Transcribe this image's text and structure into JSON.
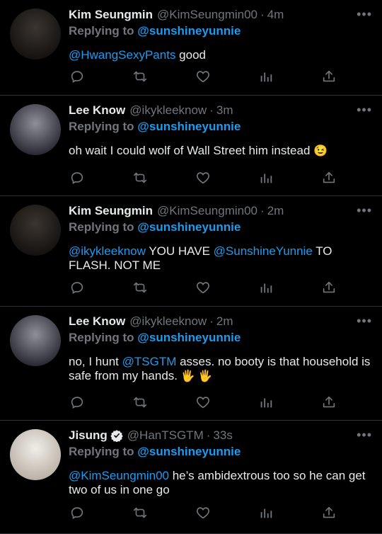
{
  "tweets": [
    {
      "name": "Kim Seungmin",
      "handle": "@KimSeungmin00",
      "time": "4m",
      "replying_prefix": "Replying to",
      "replying_handle": "@sunshineyunnie",
      "parts": [
        {
          "t": "@HwangSexyPants",
          "m": true
        },
        {
          "t": " good",
          "m": false
        }
      ],
      "avatar_colors": [
        "#3a3530",
        "#151210"
      ]
    },
    {
      "name": "Lee Know",
      "handle": "@ikykleeknow",
      "time": "3m",
      "replying_prefix": "Replying to",
      "replying_handle": "@sunshineyunnie",
      "parts": [
        {
          "t": "oh wait I could wolf of Wall Street him instead ",
          "m": false
        },
        {
          "t": "😉",
          "m": false,
          "emoji": true
        }
      ],
      "avatar_colors": [
        "#8f8f99",
        "#2c2c36"
      ]
    },
    {
      "name": "Kim Seungmin",
      "handle": "@KimSeungmin00",
      "time": "2m",
      "replying_prefix": "Replying to",
      "replying_handle": "@sunshineyunnie",
      "parts": [
        {
          "t": "@ikykleeknow",
          "m": true
        },
        {
          "t": " YOU HAVE ",
          "m": false
        },
        {
          "t": "@SunshineYunnie",
          "m": true
        },
        {
          "t": " TO FLASH. NOT ME",
          "m": false
        }
      ],
      "avatar_colors": [
        "#3a3530",
        "#151210"
      ]
    },
    {
      "name": "Lee Know",
      "handle": "@ikykleeknow",
      "time": "2m",
      "replying_prefix": "Replying to",
      "replying_handle": "@sunshineyunnie",
      "parts": [
        {
          "t": "no, I hunt ",
          "m": false
        },
        {
          "t": "@TSGTM",
          "m": true
        },
        {
          "t": " asses. no booty is that household is safe from my hands. ",
          "m": false
        },
        {
          "t": "🖐 🖐",
          "m": false,
          "emoji": true
        }
      ],
      "avatar_colors": [
        "#8f8f99",
        "#2c2c36"
      ]
    },
    {
      "name": "Jisung",
      "verified": true,
      "handle": "@HanTSGTM",
      "time": "33s",
      "replying_prefix": "Replying to",
      "replying_handle": "@sunshineyunnie",
      "parts": [
        {
          "t": "@KimSeungmin00",
          "m": true
        },
        {
          "t": " he’s ambidextrous too so he can get two of us in one go",
          "m": false
        }
      ],
      "avatar_colors": [
        "#f0ede8",
        "#bcb3a8"
      ]
    }
  ],
  "action_icons": [
    "reply-icon",
    "retweet-icon",
    "like-icon",
    "analytics-icon",
    "share-icon"
  ],
  "colors": {
    "background": "#000000",
    "link": "#1d9bf0",
    "muted": "#71767b",
    "divider": "#2f3336"
  }
}
